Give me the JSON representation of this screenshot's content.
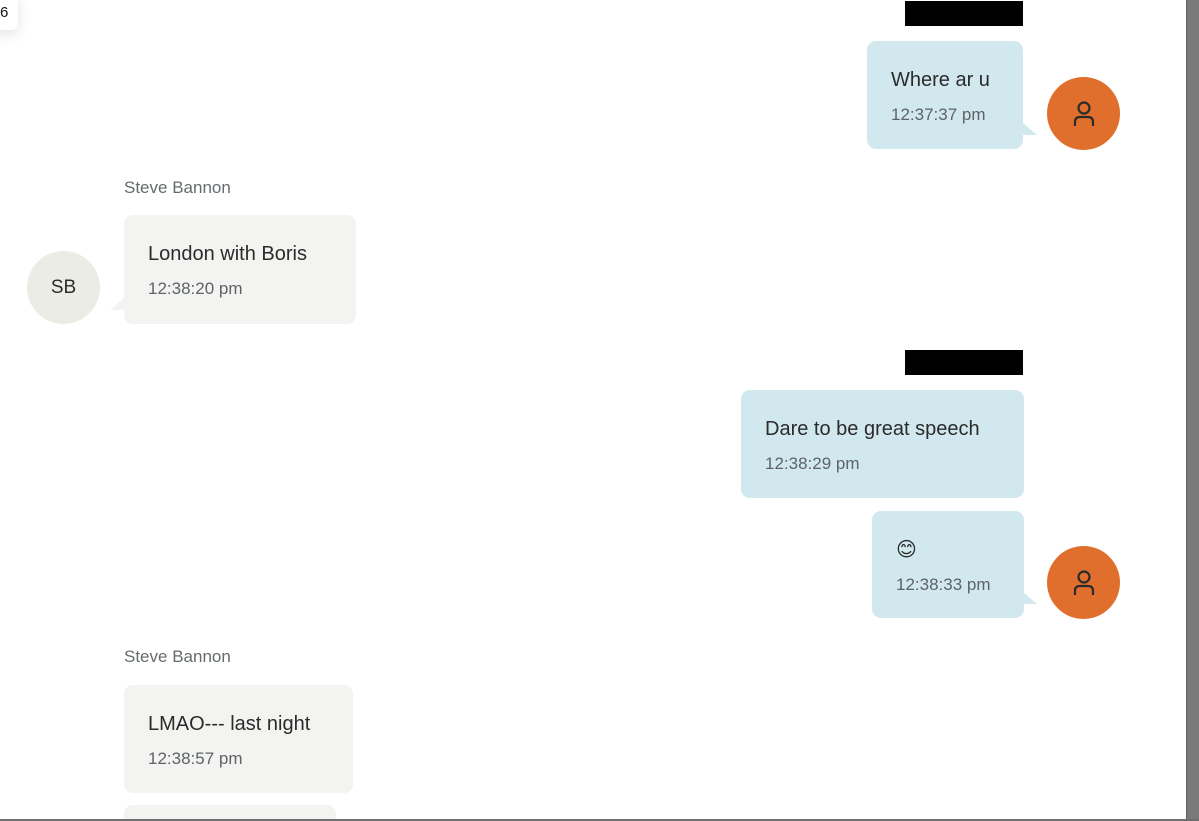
{
  "corner_badge": "6",
  "messages": [
    {
      "sender": "me",
      "text": "Where ar u",
      "time": "12:37:37 pm"
    },
    {
      "sender": "Steve Bannon",
      "text": "London with Boris",
      "time": "12:38:20 pm"
    },
    {
      "sender": "me",
      "text": "Dare to be great speech",
      "time": "12:38:29 pm"
    },
    {
      "sender": "me",
      "text": "😊",
      "time": "12:38:33 pm"
    },
    {
      "sender": "Steve Bannon",
      "text": "LMAO--- last night",
      "time": "12:38:57 pm"
    }
  ],
  "sender_labels": [
    "Steve Bannon",
    "Steve Bannon"
  ],
  "contact_avatar_initials": "SB",
  "icons": {
    "my_avatar": "person-icon"
  },
  "colors": {
    "outgoing_bubble": "#d2e8ef",
    "incoming_bubble": "#f3f3f1",
    "my_avatar": "#e06f2e",
    "contact_avatar": "#ecece6",
    "redaction": "#000000"
  }
}
